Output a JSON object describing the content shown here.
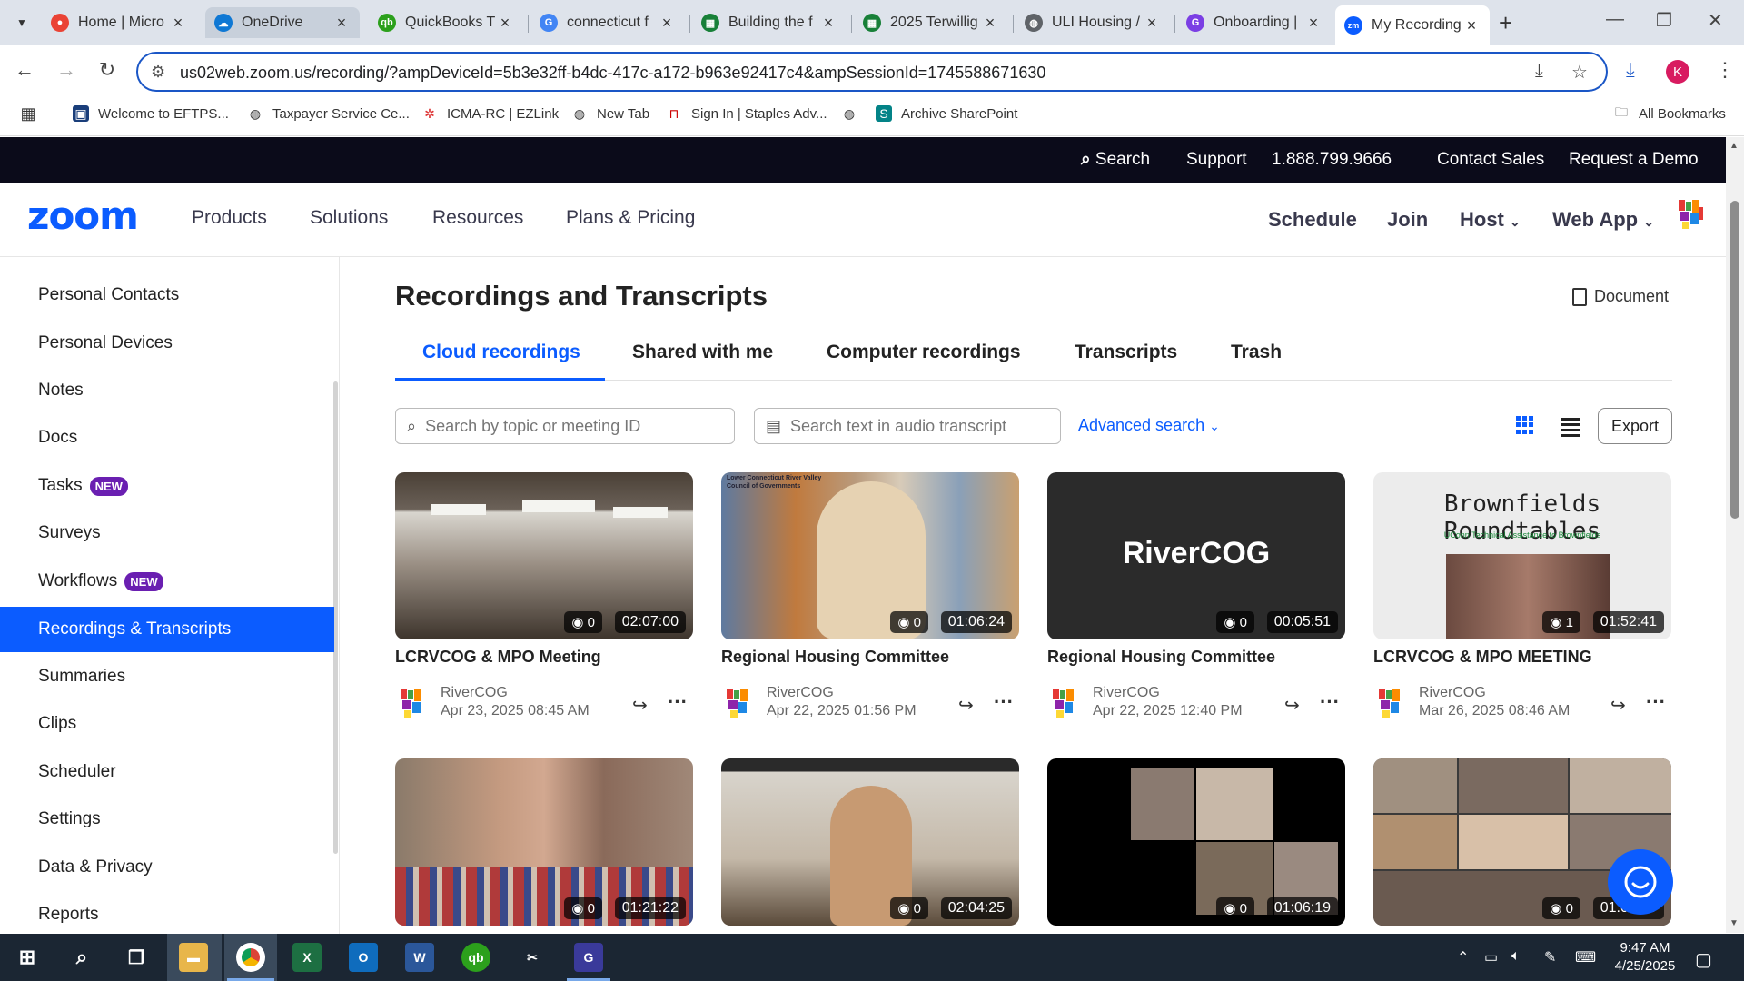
{
  "browser": {
    "tabs": [
      {
        "title": "Home | Micro",
        "color": "#ea4335"
      },
      {
        "title": "OneDrive",
        "color": "#0f78d4"
      },
      {
        "title": "QuickBooks T",
        "color": "#2ca01c"
      },
      {
        "title": "connecticut f",
        "color": "#4285f4"
      },
      {
        "title": "Building the f",
        "color": "#188038"
      },
      {
        "title": "2025 Terwillig",
        "color": "#188038"
      },
      {
        "title": "ULI Housing /",
        "color": "#5f6368"
      },
      {
        "title": "Onboarding |",
        "color": "#7b3fe4"
      },
      {
        "title": "My Recording",
        "color": "#0b5cff"
      }
    ],
    "url": "us02web.zoom.us/recording/?ampDeviceId=5b3e32ff-b4dc-417c-a172-b963e92417c4&ampSessionId=1745588671630",
    "profile_initial": "K",
    "bookmarks": [
      {
        "label": "Welcome to EFTPS..."
      },
      {
        "label": "Taxpayer Service Ce..."
      },
      {
        "label": "ICMA-RC | EZLink"
      },
      {
        "label": "New Tab"
      },
      {
        "label": "Sign In | Staples Adv..."
      },
      {
        "label": ""
      },
      {
        "label": "Archive SharePoint"
      }
    ],
    "all_bookmarks": "All Bookmarks"
  },
  "zoom": {
    "topbar": {
      "search": "Search",
      "support": "Support",
      "phone": "1.888.799.9666",
      "contact_sales": "Contact Sales",
      "request_demo": "Request a Demo"
    },
    "logo": "zoom",
    "nav_left": [
      "Products",
      "Solutions",
      "Resources",
      "Plans & Pricing"
    ],
    "nav_right": {
      "schedule": "Schedule",
      "join": "Join",
      "host": "Host",
      "web_app": "Web App"
    },
    "sidebar": [
      {
        "label": "Personal Contacts"
      },
      {
        "label": "Personal Devices"
      },
      {
        "label": "Notes"
      },
      {
        "label": "Docs"
      },
      {
        "label": "Tasks",
        "badge": "NEW"
      },
      {
        "label": "Surveys"
      },
      {
        "label": "Workflows",
        "badge": "NEW"
      },
      {
        "label": "Recordings & Transcripts",
        "active": true
      },
      {
        "label": "Summaries"
      },
      {
        "label": "Clips"
      },
      {
        "label": "Scheduler"
      },
      {
        "label": "Settings"
      },
      {
        "label": "Data & Privacy"
      },
      {
        "label": "Reports"
      }
    ],
    "page_title": "Recordings and Transcripts",
    "document_link": "Document",
    "tabs": [
      "Cloud recordings",
      "Shared with me",
      "Computer recordings",
      "Transcripts",
      "Trash"
    ],
    "search_placeholder": "Search by topic or meeting ID",
    "transcript_placeholder": "Search text in audio transcript",
    "advanced_search": "Advanced search",
    "export": "Export",
    "recordings": [
      {
        "title": "LCRVCOG & MPO Meeting",
        "host": "RiverCOG",
        "date": "Apr 23, 2025 08:45 AM",
        "views": "0",
        "duration": "02:07:00"
      },
      {
        "title": "Regional Housing Committee",
        "host": "RiverCOG",
        "date": "Apr 22, 2025 01:56 PM",
        "views": "0",
        "duration": "01:06:24",
        "thumb_text": "Lower Connecticut River Valley Council of Governments"
      },
      {
        "title": "Regional Housing Committee",
        "host": "RiverCOG",
        "date": "Apr 22, 2025 12:40 PM",
        "views": "0",
        "duration": "00:05:51",
        "thumb_text": "RiverCOG"
      },
      {
        "title": "LCRVCOG & MPO MEETING",
        "host": "RiverCOG",
        "date": "Mar 26, 2025 08:46 AM",
        "views": "1",
        "duration": "01:52:41",
        "thumb_text": "Brownfields Roundtables",
        "thumb_sub": "UConn Technical Assistance to Brownfields"
      },
      {
        "views": "0",
        "duration": "01:21:22"
      },
      {
        "views": "0",
        "duration": "02:04:25"
      },
      {
        "views": "0",
        "duration": "01:06:19"
      },
      {
        "views": "0",
        "duration": "01:04:19"
      }
    ]
  },
  "taskbar": {
    "time": "9:47 AM",
    "date": "4/25/2025"
  }
}
